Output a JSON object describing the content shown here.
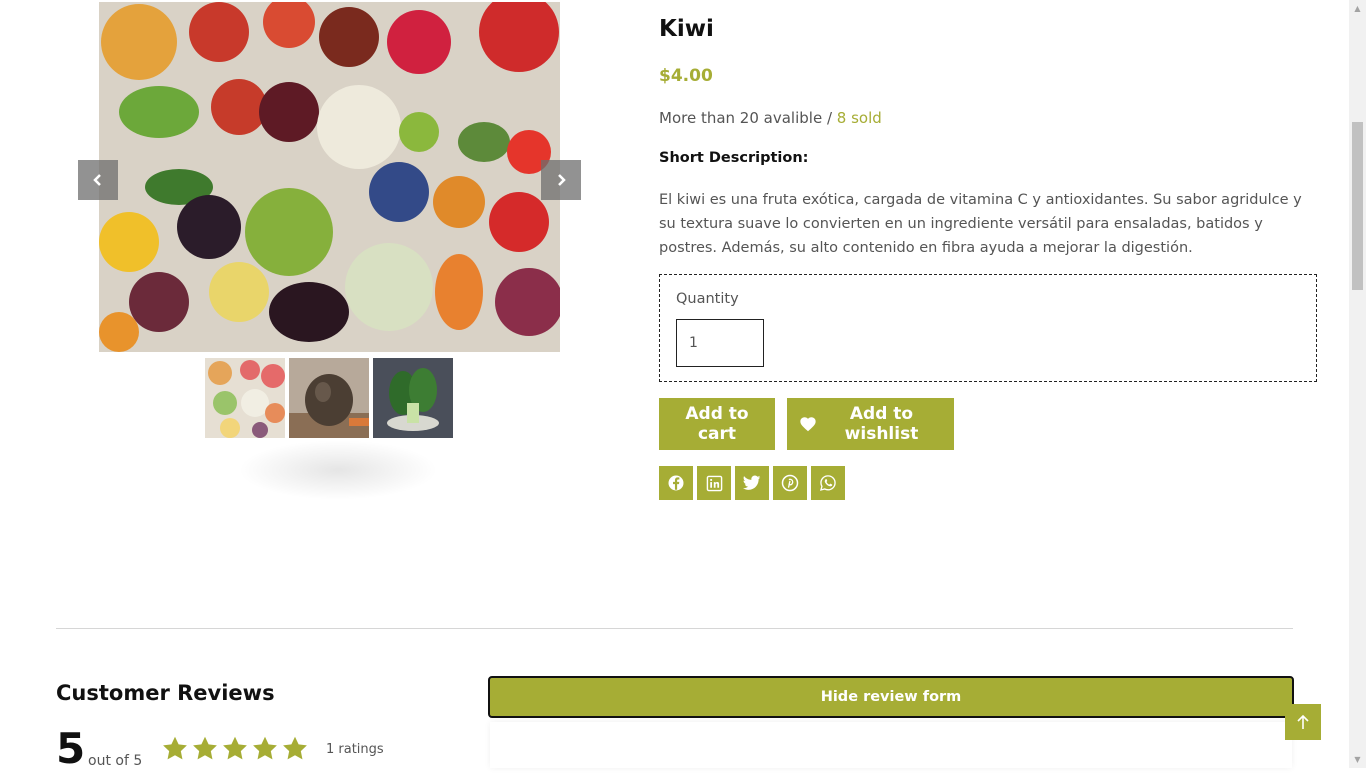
{
  "product": {
    "title": "Kiwi",
    "price": "$4.00",
    "stock_text": "More than 20 avalible / ",
    "sold_text": "8 sold",
    "short_description_label": "Short Description:",
    "description": "El kiwi es una fruta exótica, cargada de vitamina C y antioxidantes. Su sabor agridulce y su textura suave lo convierten en un ingrediente versátil para ensaladas, batidos y postres. Además, su alto contenido en fibra ayuda a mejorar la digestión.",
    "quantity_label": "Quantity",
    "quantity_value": "1"
  },
  "gallery": {
    "main_image": "vegetables-assortment-image",
    "prev_icon": "chevron-left-icon",
    "next_icon": "chevron-right-icon",
    "thumbnails": [
      "vegetables-thumbnail",
      "kiwi-thumbnail",
      "bok-choy-thumbnail"
    ]
  },
  "actions": {
    "add_to_cart": "Add to cart",
    "add_to_wishlist": "Add to wishlist",
    "wishlist_icon": "heart-icon"
  },
  "share": [
    "facebook-icon",
    "linkedin-icon",
    "twitter-icon",
    "pinterest-icon",
    "whatsapp-icon"
  ],
  "reviews": {
    "title": "Customer Reviews",
    "average": "5",
    "out_of": "out of 5",
    "stars": 5,
    "count_text": "1 ratings",
    "hide_form": "Hide review form"
  },
  "colors": {
    "accent": "#a6ad35",
    "text_muted": "#555555",
    "divider": "#d6d6d6"
  }
}
